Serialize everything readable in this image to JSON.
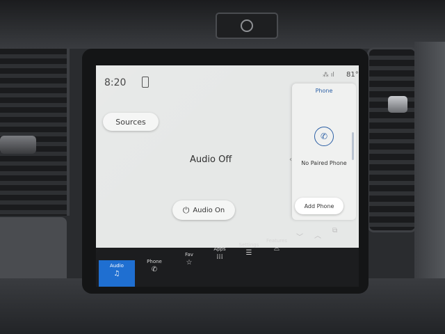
{
  "status_bar": {
    "time": "8:20",
    "temperature": "81°",
    "icons": [
      "phone-icon",
      "signal-icon"
    ]
  },
  "audio": {
    "sources_label": "Sources",
    "status": "Audio Off",
    "audio_on_label": "Audio On"
  },
  "phone_panel": {
    "title": "Phone",
    "message": "No Paired Phone",
    "add_phone_label": "Add Phone"
  },
  "nav_bar": {
    "items": [
      {
        "label": "Audio",
        "icon": "music-note-icon",
        "active": true
      },
      {
        "label": "Phone",
        "icon": "phone-icon",
        "active": false
      },
      {
        "label": "Fav",
        "icon": "star-icon",
        "active": false
      },
      {
        "label": "Apps",
        "icon": "apps-grid-icon",
        "active": false
      },
      {
        "label": "Settings",
        "icon": "sliders-icon",
        "active": false
      },
      {
        "label": "Features",
        "icon": "truck-icon",
        "active": false
      }
    ],
    "accent_color": "#1f6fd1"
  },
  "glyphs": {
    "music": "♫",
    "phone": "✆",
    "star": "☆",
    "apps": "⁞⁞⁞",
    "sliders": "☰",
    "truck": "⌓",
    "power": "⏻",
    "chevron_down": "﹀",
    "chevron_up": "︿",
    "chevron_left": "‹",
    "window": "⧉",
    "signal": "⁂ ıl",
    "call": "✆"
  }
}
